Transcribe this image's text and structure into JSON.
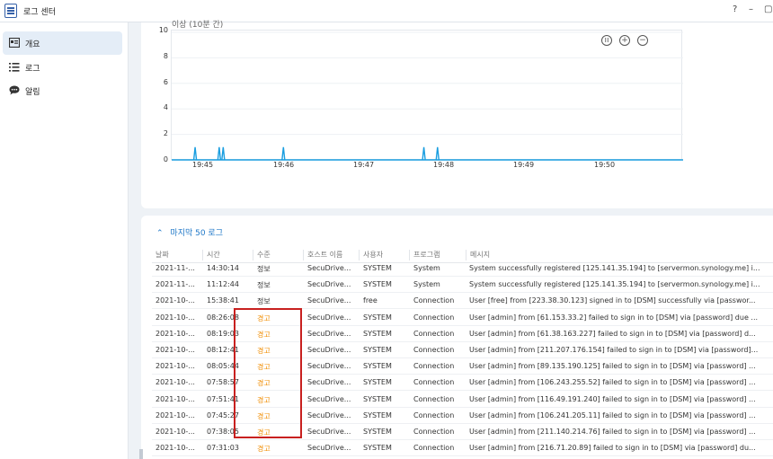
{
  "app": {
    "title": "로그 센터",
    "help": "?",
    "minimize": "–",
    "maximize": "▢"
  },
  "sidebar": {
    "items": [
      {
        "label": "개요",
        "icon": "overview-icon",
        "active": true
      },
      {
        "label": "로그",
        "icon": "list-icon",
        "active": false
      },
      {
        "label": "알림",
        "icon": "chat-icon",
        "active": false
      }
    ]
  },
  "chart": {
    "title": "이상 (10분 간)",
    "chart_data": {
      "type": "line",
      "x": [
        "19:45",
        "19:46",
        "19:47",
        "19:48",
        "19:49",
        "19:50"
      ],
      "ylim": [
        0,
        10
      ],
      "yticks": [
        "0",
        "2",
        "4",
        "6",
        "8",
        "10"
      ],
      "spikes": [
        {
          "time": "19:44.9",
          "value": 1
        },
        {
          "time": "19:45.2",
          "value": 1
        },
        {
          "time": "19:45.25",
          "value": 1
        },
        {
          "time": "19:46.0",
          "value": 1
        },
        {
          "time": "19:47.75",
          "value": 1
        },
        {
          "time": "19:47.92",
          "value": 1
        }
      ],
      "line_color": "#1a9ee0"
    }
  },
  "logs": {
    "header": "마지막 50 로그",
    "columns": [
      "날짜",
      "시간",
      "수준",
      "호스트 이름",
      "사용자",
      "프로그램",
      "메시지"
    ],
    "rows": [
      [
        "2021-11-...",
        "14:30:14",
        "정보",
        "SecuDrive...",
        "SYSTEM",
        "System",
        "System successfully registered [125.141.35.194] to [servermon.synology.me] i..."
      ],
      [
        "2021-11-...",
        "11:12:44",
        "정보",
        "SecuDrive...",
        "SYSTEM",
        "System",
        "System successfully registered [125.141.35.194] to [servermon.synology.me] i..."
      ],
      [
        "2021-10-...",
        "15:38:41",
        "정보",
        "SecuDrive...",
        "free",
        "Connection",
        "User [free] from [223.38.30.123] signed in to [DSM] successfully via [passwor..."
      ],
      [
        "2021-10-...",
        "08:26:08",
        "경고",
        "SecuDrive...",
        "SYSTEM",
        "Connection",
        "User [admin] from [61.153.33.2] failed to sign in to [DSM] via [password] due ..."
      ],
      [
        "2021-10-...",
        "08:19:03",
        "경고",
        "SecuDrive...",
        "SYSTEM",
        "Connection",
        "User [admin] from [61.38.163.227] failed to sign in to [DSM] via [password] d..."
      ],
      [
        "2021-10-...",
        "08:12:41",
        "경고",
        "SecuDrive...",
        "SYSTEM",
        "Connection",
        "User [admin] from [211.207.176.154] failed to sign in to [DSM] via [password]..."
      ],
      [
        "2021-10-...",
        "08:05:44",
        "경고",
        "SecuDrive...",
        "SYSTEM",
        "Connection",
        "User [admin] from [89.135.190.125] failed to sign in to [DSM] via [password] ..."
      ],
      [
        "2021-10-...",
        "07:58:57",
        "경고",
        "SecuDrive...",
        "SYSTEM",
        "Connection",
        "User [admin] from [106.243.255.52] failed to sign in to [DSM] via [password] ..."
      ],
      [
        "2021-10-...",
        "07:51:41",
        "경고",
        "SecuDrive...",
        "SYSTEM",
        "Connection",
        "User [admin] from [116.49.191.240] failed to sign in to [DSM] via [password] ..."
      ],
      [
        "2021-10-...",
        "07:45:27",
        "경고",
        "SecuDrive...",
        "SYSTEM",
        "Connection",
        "User [admin] from [106.241.205.11] failed to sign in to [DSM] via [password] ..."
      ],
      [
        "2021-10-...",
        "07:38:05",
        "경고",
        "SecuDrive...",
        "SYSTEM",
        "Connection",
        "User [admin] from [211.140.214.76] failed to sign in to [DSM] via [password] ..."
      ],
      [
        "2021-10-...",
        "07:31:03",
        "경고",
        "SecuDrive...",
        "SYSTEM",
        "Connection",
        "User [admin] from [216.71.20.89] failed to sign in to [DSM] via [password] du..."
      ]
    ],
    "warn_color": "#f08c00"
  }
}
